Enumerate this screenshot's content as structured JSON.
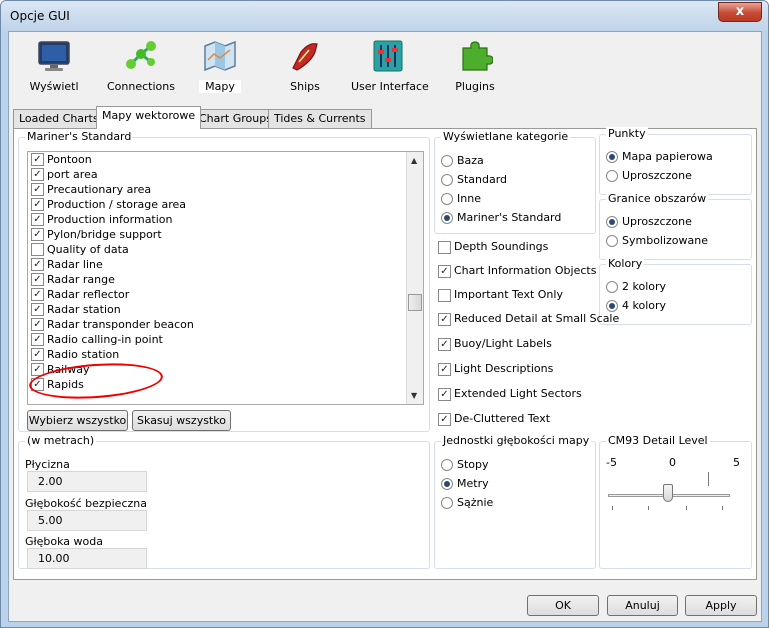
{
  "window": {
    "title": "Opcje GUI",
    "close": "x"
  },
  "toolbar": [
    {
      "label": "Wyświetl",
      "icon": "monitor-icon"
    },
    {
      "label": "Connections",
      "icon": "connections-icon"
    },
    {
      "label": "Mapy",
      "icon": "map-icon"
    },
    {
      "label": "Ships",
      "icon": "ship-icon"
    },
    {
      "label": "User Interface",
      "icon": "user-interface-icon"
    },
    {
      "label": "Plugins",
      "icon": "puzzle-icon"
    }
  ],
  "tabs": [
    "Loaded Charts",
    "Mapy wektorowe",
    "Chart Groups",
    "Tides & Currents"
  ],
  "active_tab": "Mapy wektorowe",
  "mariners": {
    "title": "Mariner's Standard",
    "items": [
      {
        "label": "Pontoon",
        "checked": true
      },
      {
        "label": "port area",
        "checked": true
      },
      {
        "label": "Precautionary area",
        "checked": true
      },
      {
        "label": "Production / storage area",
        "checked": true
      },
      {
        "label": "Production information",
        "checked": true
      },
      {
        "label": "Pylon/bridge support",
        "checked": true
      },
      {
        "label": "Quality of data",
        "checked": false
      },
      {
        "label": "Radar line",
        "checked": true
      },
      {
        "label": "Radar range",
        "checked": true
      },
      {
        "label": "Radar reflector",
        "checked": true
      },
      {
        "label": "Radar station",
        "checked": true
      },
      {
        "label": "Radar transponder beacon",
        "checked": true
      },
      {
        "label": "Radio calling-in point",
        "checked": true
      },
      {
        "label": "Radio station",
        "checked": true
      },
      {
        "label": "Railway",
        "checked": true
      },
      {
        "label": "Rapids",
        "checked": true
      }
    ],
    "select_all": "Wybierz wszystko",
    "clear_all": "Skasuj wszystko"
  },
  "categories": {
    "title": "Wyświetlane kategorie",
    "options": [
      "Baza",
      "Standard",
      "Inne",
      "Mariner's Standard"
    ],
    "selected": "Mariner's Standard"
  },
  "points": {
    "title": "Punkty",
    "options": [
      "Mapa papierowa",
      "Uproszczone"
    ],
    "selected": "Mapa papierowa"
  },
  "boundaries": {
    "title": "Granice obszarów",
    "options": [
      "Uproszczone",
      "Symbolizowane"
    ],
    "selected": "Uproszczone"
  },
  "colors": {
    "title": "Kolory",
    "options": [
      "2 kolory",
      "4 kolory"
    ],
    "selected": "4 kolory"
  },
  "checks": [
    {
      "label": "Depth Soundings",
      "checked": false
    },
    {
      "label": "Chart Information Objects",
      "checked": true
    },
    {
      "label": "Important Text Only",
      "checked": false
    },
    {
      "label": "Reduced Detail at Small Scale",
      "checked": true
    },
    {
      "label": "Buoy/Light Labels",
      "checked": true
    },
    {
      "label": "Light Descriptions",
      "checked": true
    },
    {
      "label": "Extended Light Sectors",
      "checked": true
    },
    {
      "label": "De-Cluttered Text",
      "checked": true
    }
  ],
  "depths": {
    "title": "(w metrach)",
    "shallow_label": "Płycizna",
    "shallow": "2.00",
    "safety_label": "Głębokość bezpieczna",
    "safety": "5.00",
    "deep_label": "Głęboka woda",
    "deep": "10.00"
  },
  "units": {
    "title": "Jednostki głębokości mapy",
    "options": [
      "Stopy",
      "Metry",
      "Sążnie"
    ],
    "selected": "Metry"
  },
  "cm93": {
    "title": "CM93 Detail Level",
    "min": "-5",
    "mid": "0",
    "max": "5",
    "value": 0
  },
  "buttons": {
    "ok": "OK",
    "cancel": "Anuluj",
    "apply": "Apply"
  },
  "colors_hex": {
    "annotation": "#e00000",
    "radio": "#2a4a72"
  }
}
